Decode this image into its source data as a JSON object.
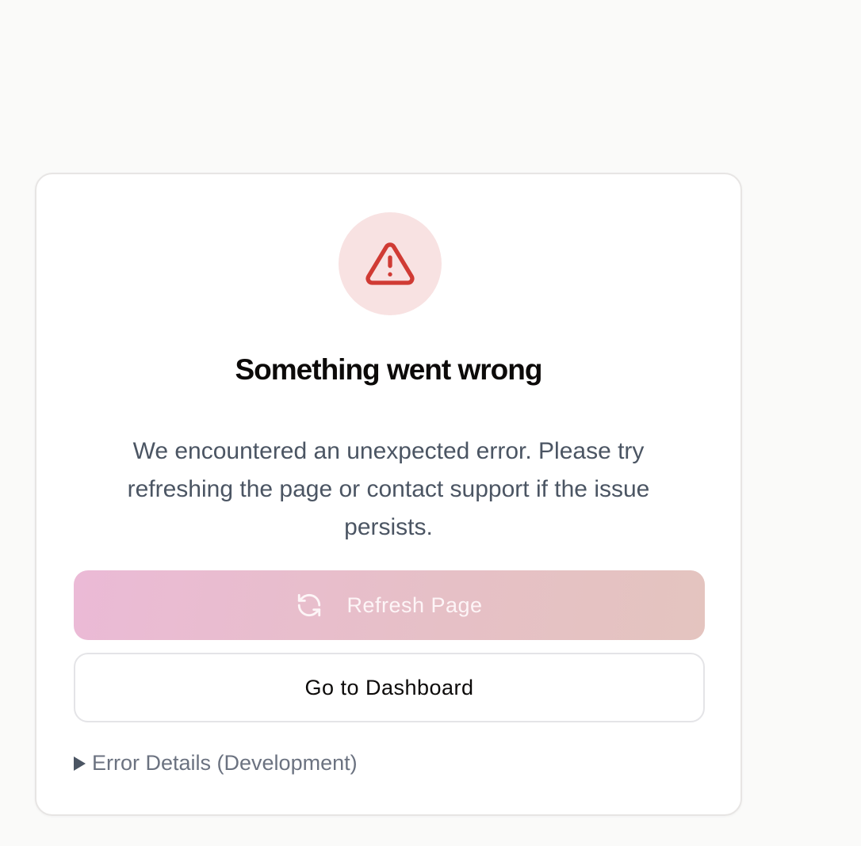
{
  "error": {
    "title": "Something went wrong",
    "message": "We encountered an unexpected error. Please try refreshing the page or contact support if the issue persists.",
    "icon": "warning-triangle-icon"
  },
  "actions": {
    "refresh_label": "Refresh Page",
    "refresh_icon": "refresh-icon",
    "dashboard_label": "Go to Dashboard"
  },
  "details": {
    "summary": "Error Details (Development)",
    "expanded": false
  },
  "colors": {
    "page_background": "#fafaf9",
    "icon_circle": "#f8e2e2",
    "icon_stroke": "#d03b34",
    "refresh_gradient_start": "#ebbad6",
    "refresh_gradient_end": "#e4c4bf"
  }
}
